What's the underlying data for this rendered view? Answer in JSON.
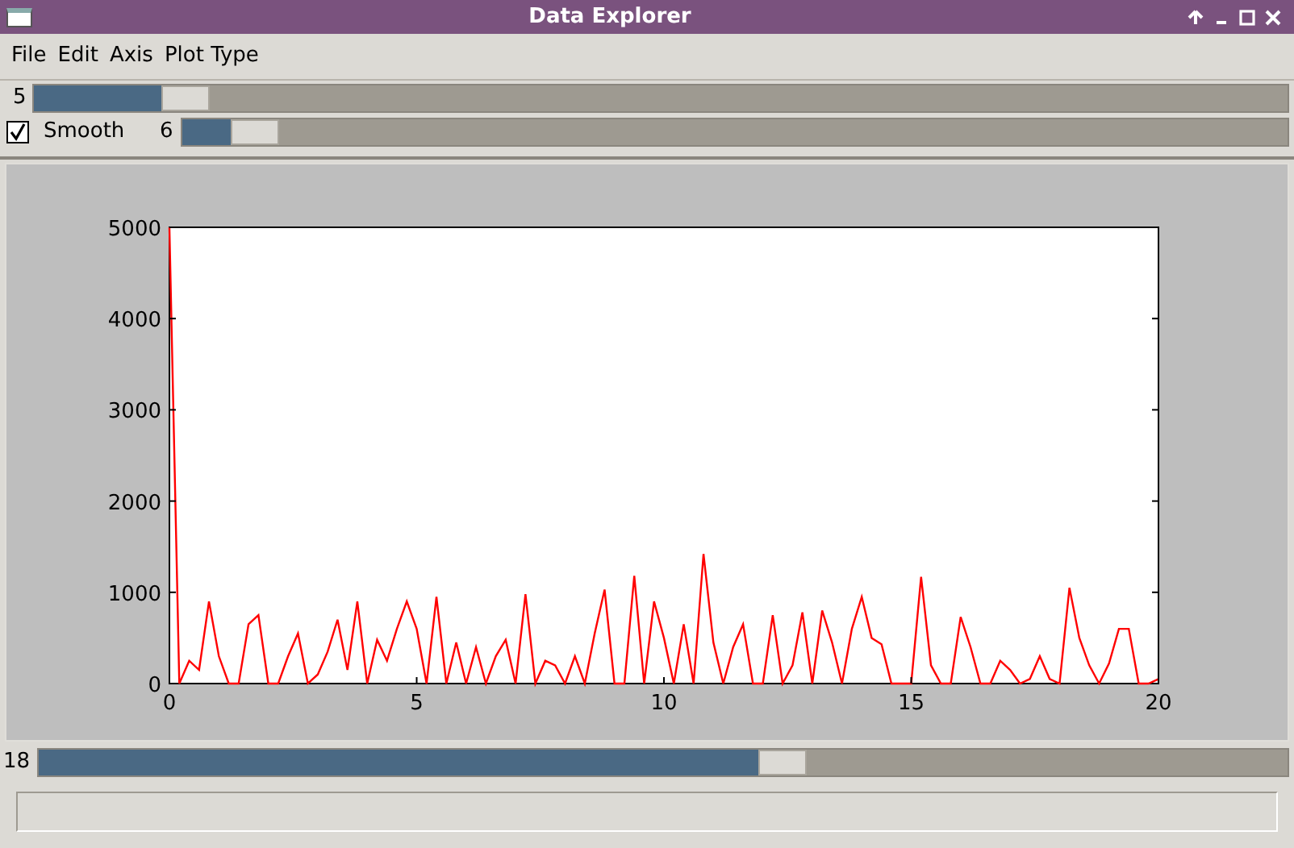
{
  "window": {
    "title": "Data Explorer"
  },
  "menu": [
    "File",
    "Edit",
    "Axis",
    "Plot Type"
  ],
  "slider_top": {
    "value": "5",
    "level": 0.106
  },
  "smooth": {
    "label": "Smooth",
    "checked": true,
    "value": "6",
    "level": 0.046
  },
  "plot": {
    "chart_data": {
      "type": "line",
      "xlim": [
        0,
        20
      ],
      "ylim": [
        0,
        5000
      ],
      "xticks": [
        0,
        5,
        10,
        15,
        20
      ],
      "yticks": [
        0,
        1000,
        2000,
        3000,
        4000,
        5000
      ],
      "x": [
        0,
        0.2,
        0.4,
        0.6,
        0.8,
        1,
        1.2,
        1.4,
        1.6,
        1.8,
        2,
        2.2,
        2.4,
        2.6,
        2.8,
        3,
        3.2,
        3.4,
        3.6,
        3.8,
        4,
        4.2,
        4.4,
        4.6,
        4.8,
        5,
        5.2,
        5.4,
        5.6,
        5.8,
        6,
        6.2,
        6.4,
        6.6,
        6.8,
        7,
        7.2,
        7.4,
        7.6,
        7.8,
        8,
        8.2,
        8.4,
        8.6,
        8.8,
        9,
        9.2,
        9.4,
        9.6,
        9.8,
        10,
        10.2,
        10.4,
        10.6,
        10.8,
        11,
        11.2,
        11.4,
        11.6,
        11.8,
        12,
        12.2,
        12.4,
        12.6,
        12.8,
        13,
        13.2,
        13.4,
        13.6,
        13.8,
        14,
        14.2,
        14.4,
        14.6,
        14.8,
        15,
        15.2,
        15.4,
        15.6,
        15.8,
        16,
        16.2,
        16.4,
        16.6,
        16.8,
        17,
        17.2,
        17.4,
        17.6,
        17.8,
        18,
        18.2,
        18.4,
        18.6,
        18.8,
        19,
        19.2,
        19.4,
        19.6,
        19.8,
        20
      ],
      "series": [
        {
          "color": "#ff0000",
          "values": [
            5000,
            0,
            250,
            150,
            900,
            300,
            0,
            0,
            650,
            750,
            0,
            0,
            300,
            550,
            0,
            100,
            350,
            700,
            150,
            900,
            0,
            480,
            250,
            600,
            900,
            600,
            0,
            950,
            0,
            450,
            0,
            400,
            0,
            300,
            480,
            0,
            980,
            0,
            250,
            200,
            0,
            300,
            0,
            550,
            1030,
            0,
            0,
            1180,
            0,
            900,
            500,
            0,
            650,
            0,
            1420,
            450,
            0,
            400,
            650,
            0,
            0,
            750,
            0,
            200,
            780,
            0,
            800,
            450,
            0,
            600,
            950,
            500,
            430,
            0,
            0,
            0,
            1170,
            200,
            0,
            0,
            730,
            400,
            0,
            0,
            250,
            150,
            0,
            50,
            300,
            50,
            0,
            1050,
            500,
            200,
            0,
            220,
            600,
            600,
            0,
            0,
            50
          ]
        }
      ]
    }
  },
  "slider_bottom": {
    "value": "18",
    "level": 0.6
  }
}
